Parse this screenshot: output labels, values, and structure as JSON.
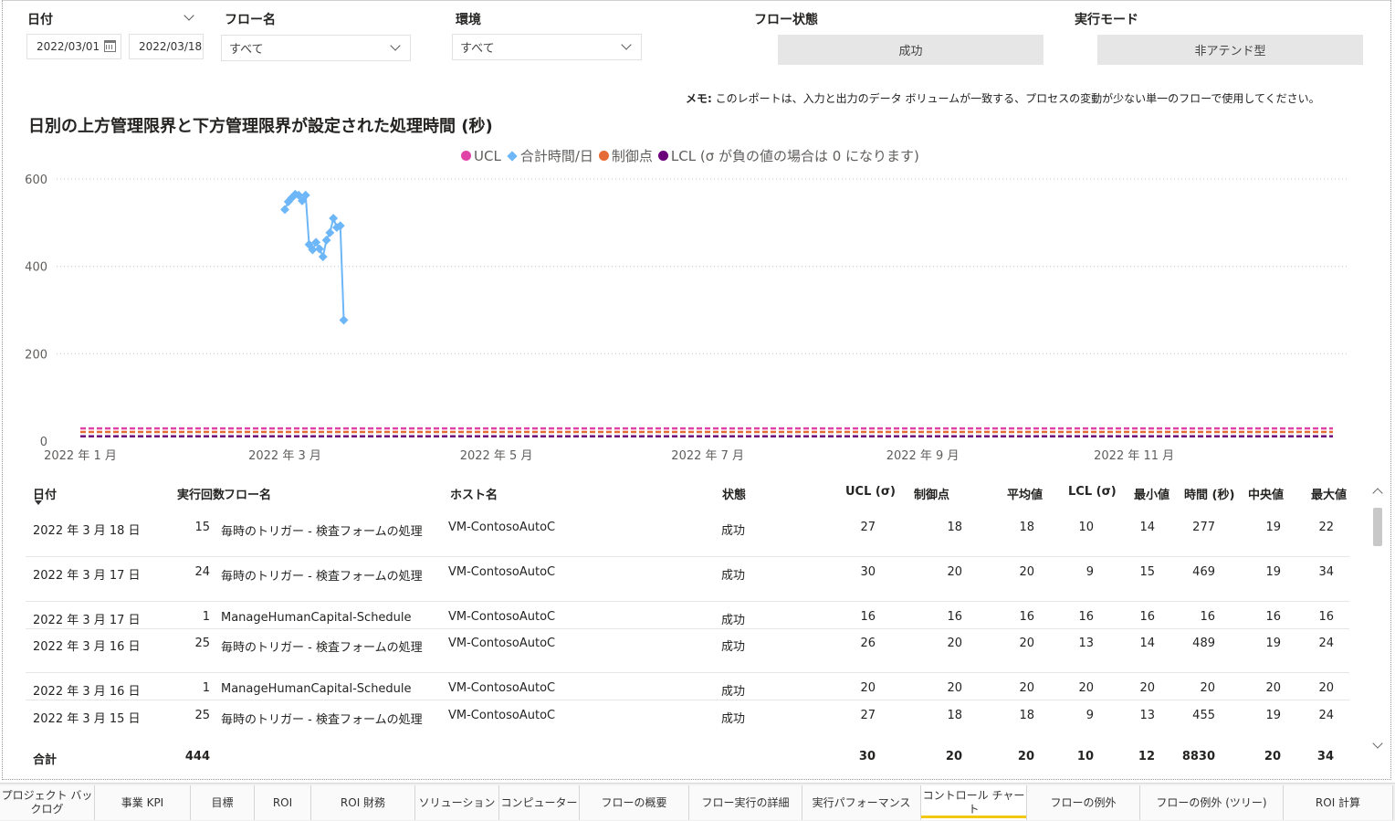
{
  "filters": {
    "date": {
      "label": "日付",
      "start": "2022/03/01",
      "end": "2022/03/18"
    },
    "flow_name": {
      "label": "フロー名",
      "value": "すべて"
    },
    "environment": {
      "label": "環境",
      "value": "すべて"
    },
    "flow_state": {
      "label": "フロー状態",
      "value": "成功"
    },
    "run_mode": {
      "label": "実行モード",
      "value": "非アテンド型"
    }
  },
  "note": {
    "prefix": "メモ:",
    "text": " このレポートは、入力と出力のデータ ボリュームが一致する、プロセスの変動が少ない単一のフローで使用してください。"
  },
  "chart_data": {
    "type": "line",
    "title": "日別の上方管理限界と下方管理限界が設定された処理時間 (秒)",
    "legend_position": "top-center",
    "grid": true,
    "y_ticks": [
      "600",
      "400",
      "200",
      "0"
    ],
    "ylim": [
      0,
      600
    ],
    "x_ticks": [
      "2022 年 1 月",
      "2022 年 3 月",
      "2022 年 5 月",
      "2022 年 7 月",
      "2022 年 9 月",
      "2022 年 11 月"
    ],
    "x_tick_dates": [
      "2022-01-01",
      "2022-03-01",
      "2022-05-01",
      "2022-07-01",
      "2022-09-01",
      "2022-11-01"
    ],
    "xlim": [
      "2022-01-01",
      "2022-12-31"
    ],
    "series": [
      {
        "name": "UCL",
        "color": "#e044a7",
        "style": "dashed",
        "x": [
          "2022-01-01",
          "2022-12-31"
        ],
        "y": [
          29,
          29
        ]
      },
      {
        "name": "合計時間/日",
        "color": "#6db6f7",
        "style": "solid-marker",
        "x": [
          "2022-03-01",
          "2022-03-02",
          "2022-03-03",
          "2022-03-04",
          "2022-03-05",
          "2022-03-06",
          "2022-03-07",
          "2022-03-08",
          "2022-03-09",
          "2022-03-10",
          "2022-03-11",
          "2022-03-12",
          "2022-03-13",
          "2022-03-14",
          "2022-03-15",
          "2022-03-16",
          "2022-03-17",
          "2022-03-18"
        ],
        "y": [
          530,
          548,
          557,
          565,
          563,
          550,
          563,
          450,
          438,
          455,
          440,
          422,
          460,
          477,
          510,
          489,
          493,
          277
        ]
      },
      {
        "name": "制御点",
        "color": "#e66c37",
        "style": "dashed",
        "x": [
          "2022-01-01",
          "2022-12-31"
        ],
        "y": [
          21,
          21
        ]
      },
      {
        "name": "LCL (σ が負の値の場合は 0 になります)",
        "color": "#6b007b",
        "style": "dashed",
        "x": [
          "2022-01-01",
          "2022-12-31"
        ],
        "y": [
          11,
          11
        ]
      }
    ]
  },
  "table": {
    "headers": {
      "date": "日付",
      "runs": "実行回数",
      "flow": "フロー名",
      "host": "ホスト名",
      "state": "状態",
      "ucl": "UCL (σ)",
      "cp": "制御点",
      "avg": "平均値",
      "lcl": "LCL (σ)",
      "min": "最小値",
      "time": "時間 (秒)",
      "median": "中央値",
      "max": "最大値"
    },
    "rows": [
      {
        "date": "2022 年 3 月 18 日",
        "runs": "15",
        "flow": "毎時のトリガー - 検査フォームの処理",
        "host": "VM-ContosoAutoC",
        "state": "成功",
        "ucl": "27",
        "cp": "18",
        "avg": "18",
        "lcl": "10",
        "min": "14",
        "time": "277",
        "median": "19",
        "max": "22"
      },
      {
        "date": "2022 年 3 月 17 日",
        "runs": "24",
        "flow": "毎時のトリガー - 検査フォームの処理",
        "host": "VM-ContosoAutoC",
        "state": "成功",
        "ucl": "30",
        "cp": "20",
        "avg": "20",
        "lcl": "9",
        "min": "15",
        "time": "469",
        "median": "19",
        "max": "34"
      },
      {
        "date": "2022 年 3 月 17 日",
        "runs": "1",
        "flow": "ManageHumanCapital-Schedule",
        "host": "VM-ContosoAutoC",
        "state": "成功",
        "ucl": "16",
        "cp": "16",
        "avg": "16",
        "lcl": "16",
        "min": "16",
        "time": "16",
        "median": "16",
        "max": "16"
      },
      {
        "date": "2022 年 3 月 16 日",
        "runs": "25",
        "flow": "毎時のトリガー - 検査フォームの処理",
        "host": "VM-ContosoAutoC",
        "state": "成功",
        "ucl": "26",
        "cp": "20",
        "avg": "20",
        "lcl": "13",
        "min": "14",
        "time": "489",
        "median": "19",
        "max": "24"
      },
      {
        "date": "2022 年 3 月 16 日",
        "runs": "1",
        "flow": "ManageHumanCapital-Schedule",
        "host": "VM-ContosoAutoC",
        "state": "成功",
        "ucl": "20",
        "cp": "20",
        "avg": "20",
        "lcl": "20",
        "min": "20",
        "time": "20",
        "median": "20",
        "max": "20"
      },
      {
        "date": "2022 年 3 月 15 日",
        "runs": "25",
        "flow": "毎時のトリガー - 検査フォームの処理",
        "host": "VM-ContosoAutoC",
        "state": "成功",
        "ucl": "27",
        "cp": "18",
        "avg": "18",
        "lcl": "9",
        "min": "13",
        "time": "455",
        "median": "19",
        "max": "24"
      }
    ],
    "total": {
      "label": "合計",
      "runs": "444",
      "ucl": "30",
      "cp": "20",
      "avg": "20",
      "lcl": "10",
      "min": "12",
      "time": "8830",
      "median": "20",
      "max": "34"
    }
  },
  "tabs": [
    {
      "label": "プロジェクト バックログ"
    },
    {
      "label": "事業 KPI"
    },
    {
      "label": "目標"
    },
    {
      "label": "ROI"
    },
    {
      "label": "ROI 財務"
    },
    {
      "label": "ソリューション"
    },
    {
      "label": "コンピューター"
    },
    {
      "label": "フローの概要"
    },
    {
      "label": "フロー実行の詳細"
    },
    {
      "label": "実行パフォーマンス"
    },
    {
      "label": "コントロール チャート",
      "active": true
    },
    {
      "label": "フローの例外"
    },
    {
      "label": "フローの例外 (ツリー)"
    },
    {
      "label": "ROI 計算"
    }
  ]
}
